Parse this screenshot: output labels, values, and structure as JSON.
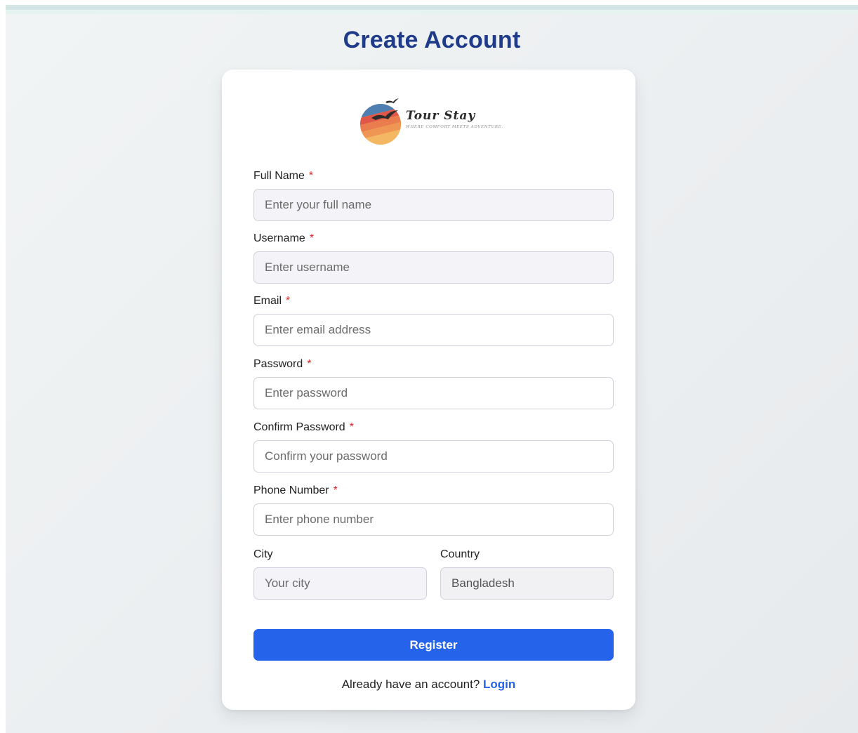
{
  "page": {
    "title": "Create Account"
  },
  "brand": {
    "name": "Tour Stay",
    "tagline": "WHERE COMFORT MEETS ADVENTURE.",
    "logo_icon": "sunset-globe-bird-icon"
  },
  "form": {
    "required_marker": "*",
    "full_name": {
      "label": "Full Name",
      "placeholder": "Enter your full name",
      "value": ""
    },
    "username": {
      "label": "Username",
      "placeholder": "Enter username",
      "value": ""
    },
    "email": {
      "label": "Email",
      "placeholder": "Enter email address",
      "value": ""
    },
    "password": {
      "label": "Password",
      "placeholder": "Enter password",
      "value": ""
    },
    "confirm_password": {
      "label": "Confirm Password",
      "placeholder": "Confirm your password",
      "value": ""
    },
    "phone": {
      "label": "Phone Number",
      "placeholder": "Enter phone number",
      "value": ""
    },
    "city": {
      "label": "City",
      "placeholder": "Your city",
      "value": ""
    },
    "country": {
      "label": "Country",
      "value": "Bangladesh"
    },
    "submit_label": "Register"
  },
  "footer": {
    "prompt": "Already have an account?",
    "login_label": "Login"
  },
  "colors": {
    "title": "#1f3b8a",
    "primary": "#2563eb",
    "required": "#e02424",
    "card_background": "#ffffff",
    "page_background": "#eceff1"
  }
}
